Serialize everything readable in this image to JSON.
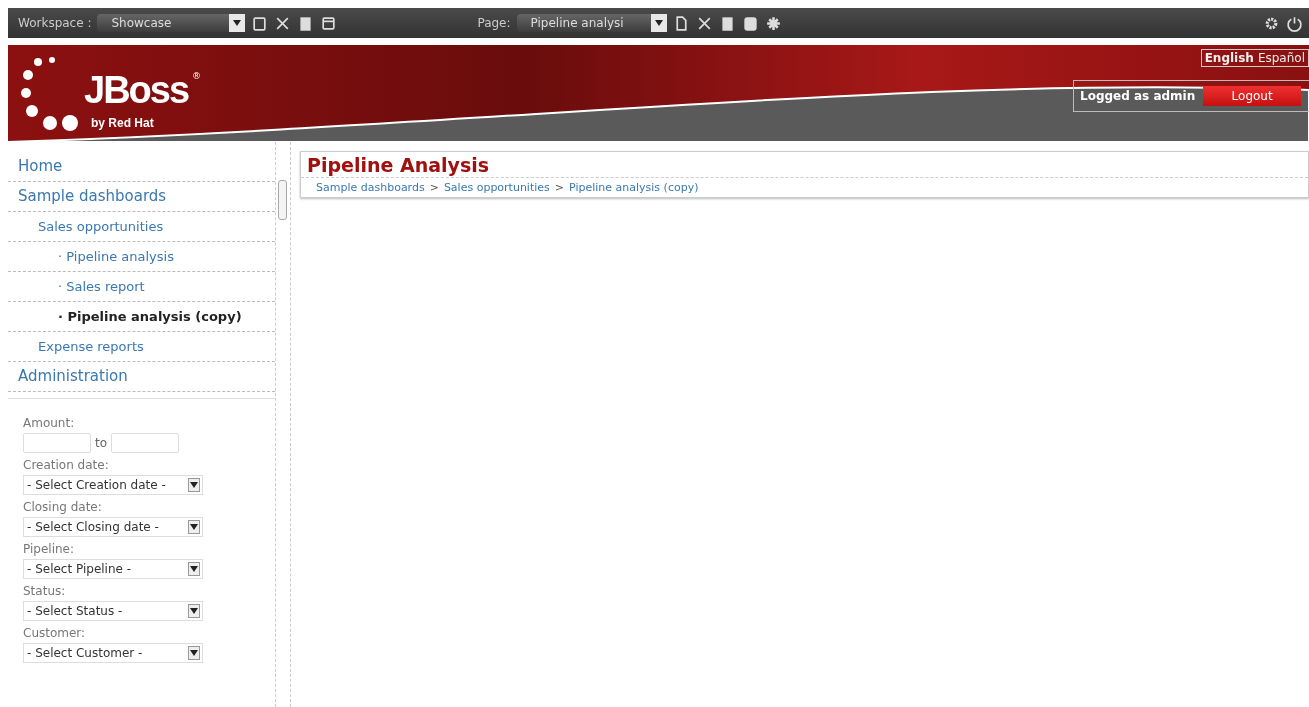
{
  "toolbar": {
    "workspace_label": "Workspace :",
    "workspace_value": "Showcase",
    "page_label": "Page:",
    "page_value": "Pipeline analysi"
  },
  "header": {
    "logo": {
      "name": "JBoss",
      "mark": "®",
      "tagline": "by Red Hat"
    },
    "languages": [
      {
        "label": "English",
        "selected": true
      },
      {
        "label": "Español",
        "selected": false
      }
    ],
    "user_label": "Logged as admin",
    "logout": "Logout"
  },
  "menu": [
    {
      "label": "Home",
      "selected": false
    },
    {
      "label": "Sample dashboards",
      "selected": false,
      "children": [
        {
          "label": "Sales opportunities",
          "selected": false,
          "children": [
            {
              "label": "· Pipeline analysis",
              "selected": false
            },
            {
              "label": "· Sales report",
              "selected": false
            },
            {
              "label": "· Pipeline analysis (copy)",
              "selected": true
            }
          ]
        },
        {
          "label": "Expense reports",
          "selected": false
        }
      ]
    },
    {
      "label": "Administration",
      "selected": false
    }
  ],
  "filters": [
    {
      "kind": "range",
      "label": "Amount:",
      "between": "to"
    },
    {
      "kind": "select",
      "label": "Creation date:",
      "value": "- Select Creation date -"
    },
    {
      "kind": "select",
      "label": "Closing date:",
      "value": "- Select Closing date -"
    },
    {
      "kind": "select",
      "label": "Pipeline:",
      "value": "- Select Pipeline -"
    },
    {
      "kind": "select",
      "label": "Status:",
      "value": "- Select Status -"
    },
    {
      "kind": "select",
      "label": "Customer:",
      "value": "- Select Customer -"
    }
  ],
  "content": {
    "title": "Pipeline Analysis",
    "breadcrumb": [
      "Sample dashboards",
      "Sales opportunities",
      "Pipeline analysis (copy)"
    ],
    "separator": ">"
  }
}
